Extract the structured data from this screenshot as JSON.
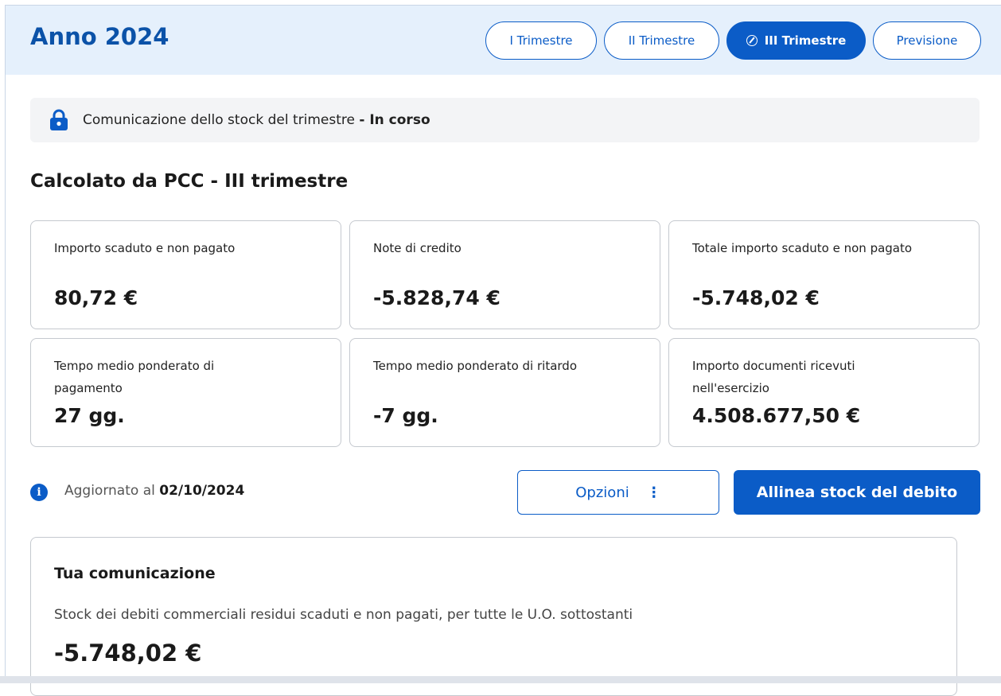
{
  "header": {
    "title": "Anno 2024",
    "tabs": [
      {
        "label": "I Trimestre",
        "active": false
      },
      {
        "label": "II Trimestre",
        "active": false
      },
      {
        "label": "III Trimestre",
        "active": true
      },
      {
        "label": "Previsione",
        "active": false
      }
    ]
  },
  "status": {
    "icon": "lock-icon",
    "text": "Comunicazione dello stock del trimestre",
    "state": "- In corso"
  },
  "section_title": "Calcolato da PCC - III trimestre",
  "cards": [
    {
      "label": "Importo scaduto e non pagato",
      "value": "80,72 €"
    },
    {
      "label": "Note di credito",
      "value": "-5.828,74 €"
    },
    {
      "label": "Totale importo scaduto e non pagato",
      "value": "-5.748,02 €"
    },
    {
      "label": "Tempo medio ponderato di pagamento",
      "value": "27 gg."
    },
    {
      "label": "Tempo medio ponderato di ritardo",
      "value": "-7 gg."
    },
    {
      "label": "Importo documenti ricevuti nell'esercizio",
      "value": "4.508.677,50 €"
    }
  ],
  "info": {
    "prefix": "Aggiornato al",
    "date": "02/10/2024"
  },
  "buttons": {
    "options": "Opzioni",
    "options_dots": "⋮",
    "primary": "Allinea stock del debito"
  },
  "communication": {
    "title": "Tua comunicazione",
    "description": "Stock dei debiti commerciali residui scaduti e non pagati, per tutte le U.O. sottostanti",
    "value": "-5.748,02 €"
  },
  "colors": {
    "primary": "#0b5cc7",
    "header_bg": "#e5f0fc",
    "title": "#0b52a8"
  }
}
